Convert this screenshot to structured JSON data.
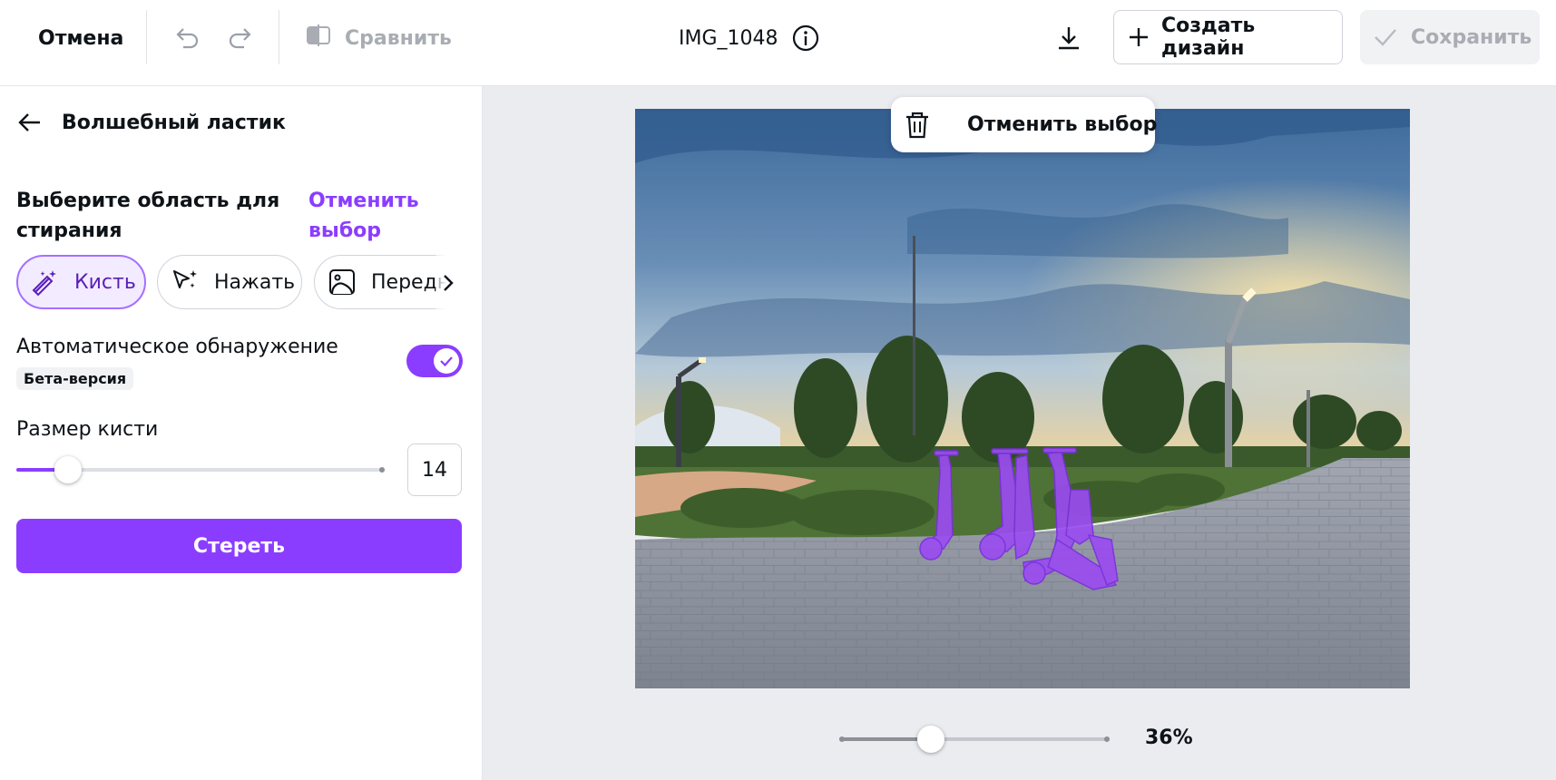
{
  "topbar": {
    "cancel_label": "Отмена",
    "compare_label": "Сравнить",
    "file_name": "IMG_1048",
    "create_design_label": "Создать дизайн",
    "save_label": "Сохранить"
  },
  "panel": {
    "title": "Волшебный ластик",
    "section_title": "Выберите область для стирания",
    "deselect_label": "Отменить выбор",
    "tools": [
      {
        "label": "Кисть",
        "icon": "magic-brush-icon",
        "active": true
      },
      {
        "label": "Нажать",
        "icon": "magic-click-icon",
        "active": false
      },
      {
        "label": "Передни",
        "icon": "foreground-image-icon",
        "active": false
      }
    ],
    "auto_detect_label": "Автоматическое обнаружение",
    "auto_detect_on": true,
    "beta_label": "Бета-версия",
    "brush_size_label": "Размер кисти",
    "brush_size_value": "14",
    "brush_size_fraction": 0.14,
    "erase_label": "Стереть"
  },
  "canvas": {
    "floating_bar_label": "Отменить выбор",
    "zoom_label": "36%",
    "zoom_fraction": 0.34
  },
  "colors": {
    "accent": "#8b3dff",
    "selection_overlay": "#9a4cf0"
  }
}
